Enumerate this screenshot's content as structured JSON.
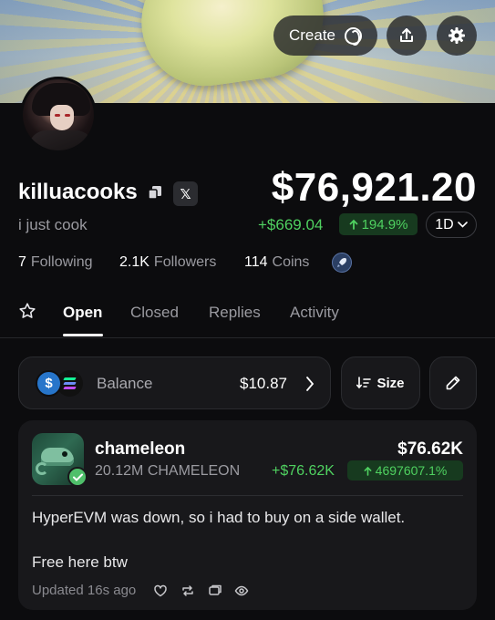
{
  "header": {
    "create_label": "Create",
    "create_icon": "coin-ring-icon",
    "share_icon": "share-icon",
    "settings_icon": "gear-icon"
  },
  "profile": {
    "username": "killuacooks",
    "bio": "i just cook",
    "total_value": "$76,921.20",
    "pnl": "+$669.04",
    "pnl_pct": "194.9%",
    "period": "1D",
    "stats": {
      "following_count": "7",
      "following_label": "Following",
      "followers_count": "2.1K",
      "followers_label": "Followers",
      "coins_count": "114",
      "coins_label": "Coins"
    },
    "social_badge": "𝕏"
  },
  "tabs": {
    "items": [
      "Open",
      "Closed",
      "Replies",
      "Activity"
    ],
    "active": "Open"
  },
  "balance": {
    "label": "Balance",
    "value": "$10.87",
    "usdc_glyph": "$",
    "size_label": "Size"
  },
  "holding": {
    "name": "chameleon",
    "amount": "20.12M CHAMELEON",
    "value": "$76.62K",
    "pnl": "+$76.62K",
    "pnl_pct": "4697607.1%",
    "post_line1": "HyperEVM was down, so i had to buy on a side wallet.",
    "post_line2": "Free here btw",
    "updated": "Updated 16s ago"
  },
  "colors": {
    "background": "#0c0c0e",
    "card": "#18181b",
    "positive": "#4fd160",
    "positive_bg": "#173a1f",
    "muted": "#9a9aa0"
  }
}
